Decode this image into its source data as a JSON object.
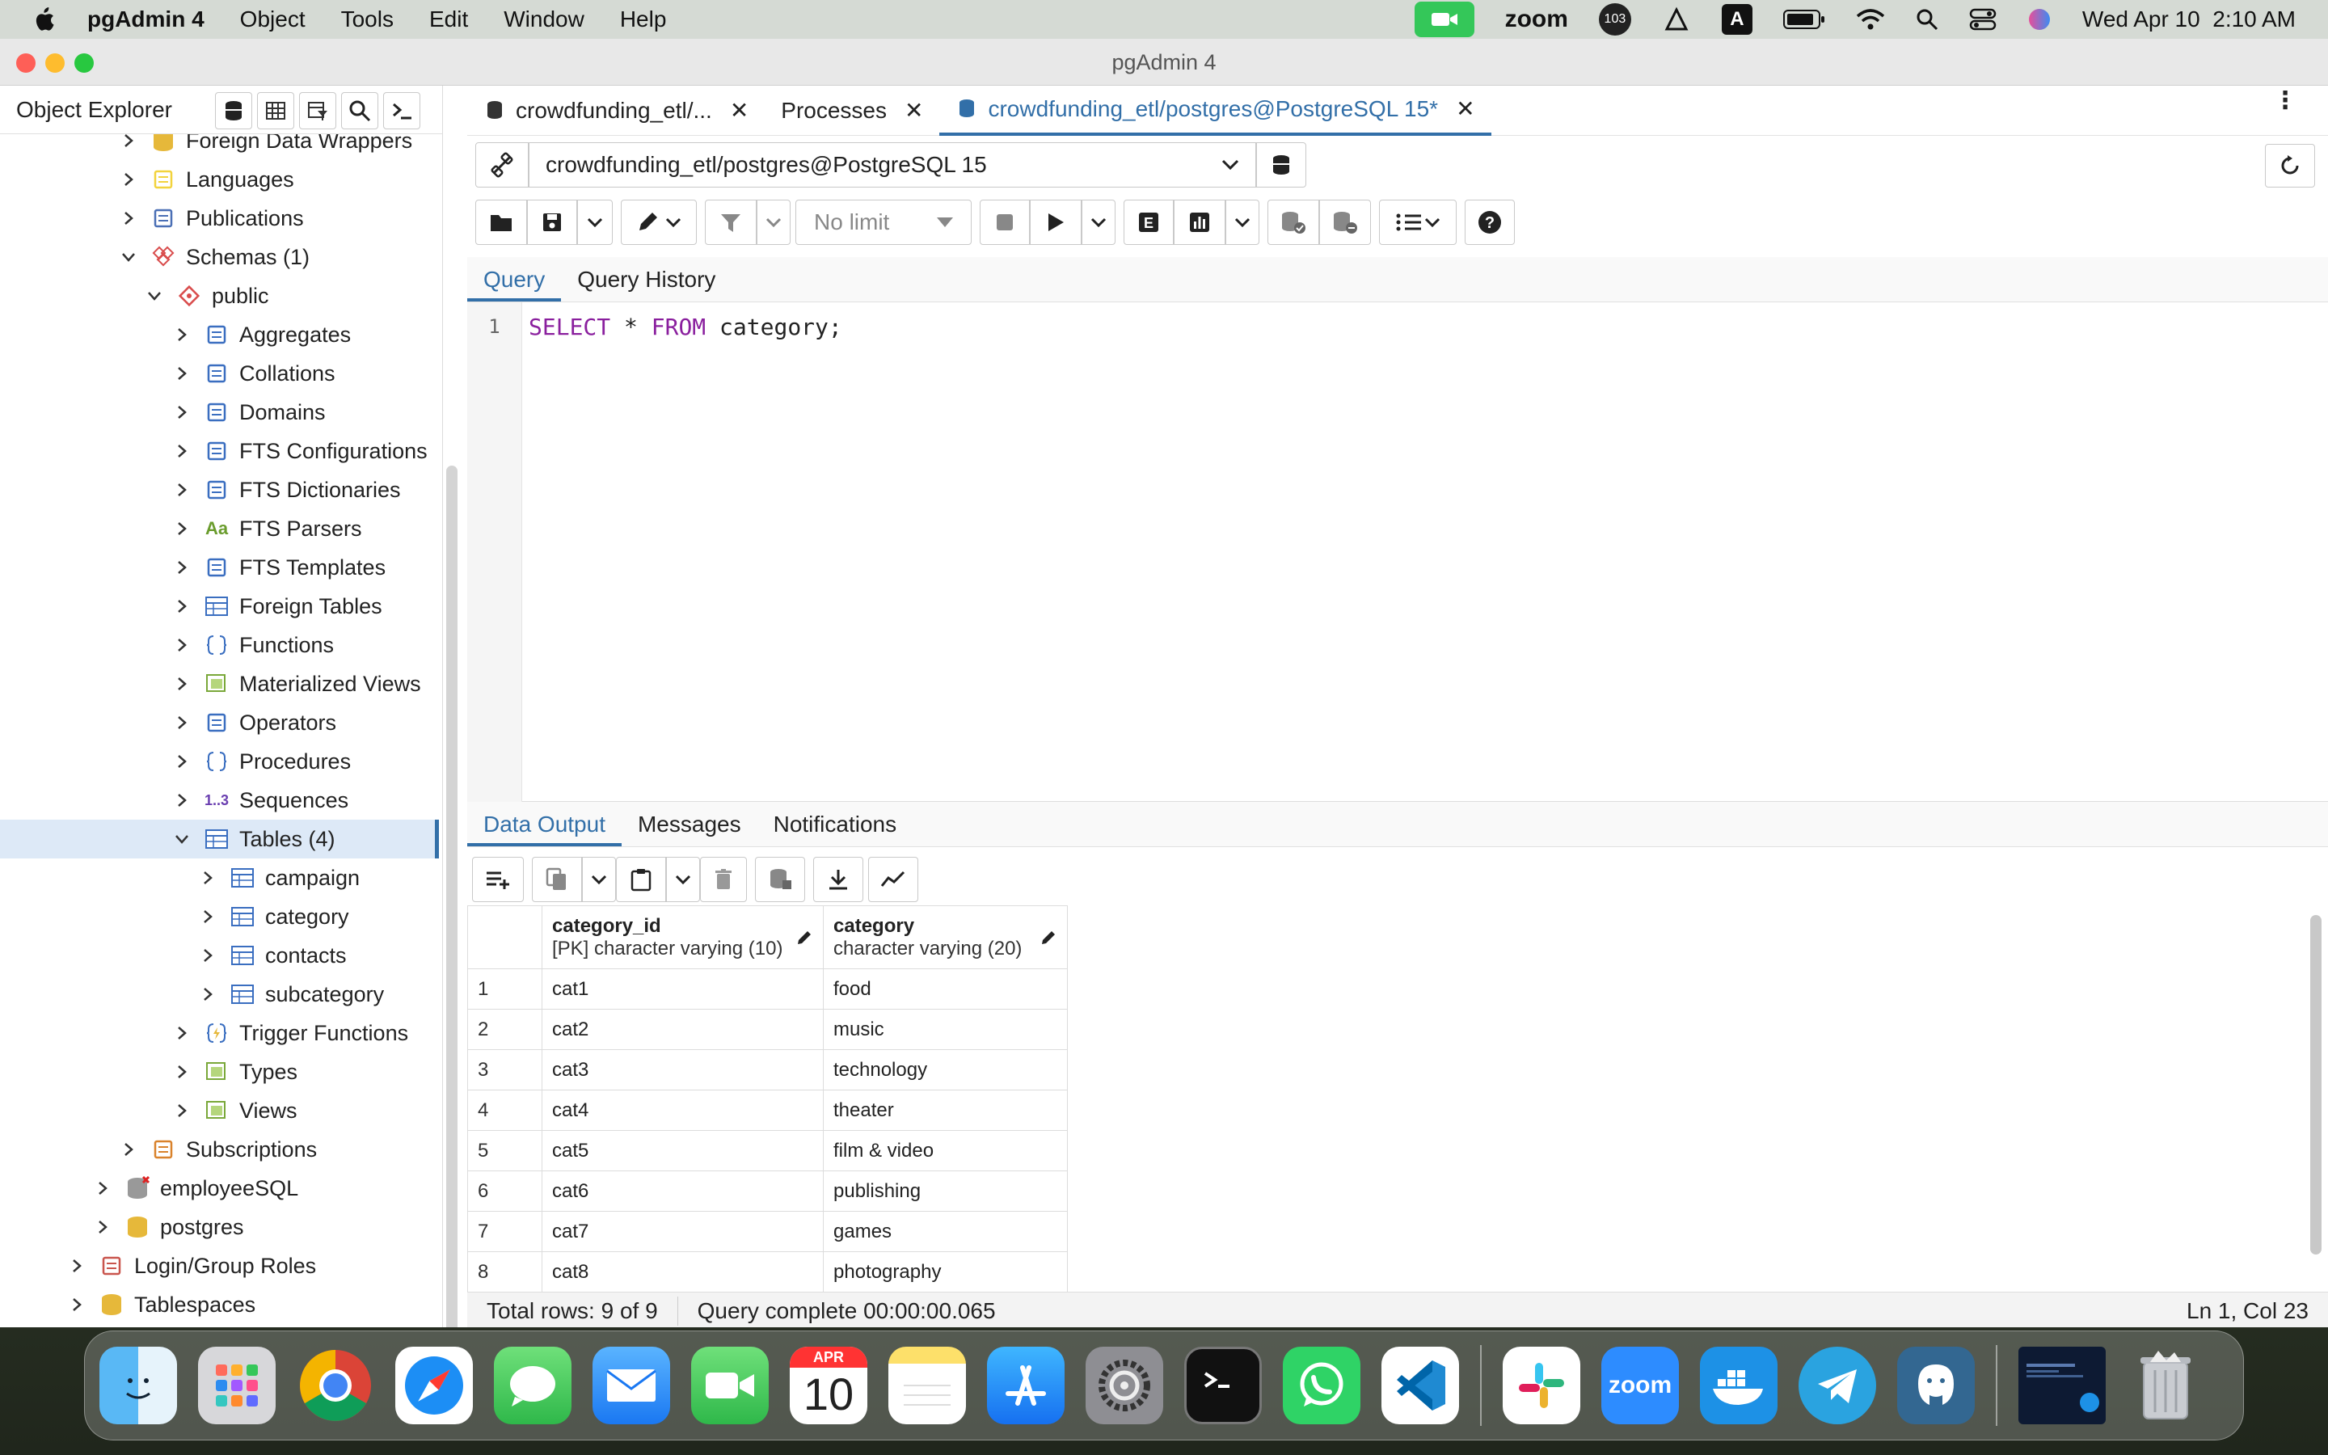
{
  "menubar": {
    "app_name": "pgAdmin 4",
    "items": [
      "Object",
      "Tools",
      "Edit",
      "Window",
      "Help"
    ],
    "zoom_label": "zoom",
    "notification_count": "103",
    "datetime": "Wed Apr 10  2:10 AM"
  },
  "window": {
    "title": "pgAdmin 4"
  },
  "sidebar": {
    "title": "Object Explorer",
    "tree": [
      {
        "label": "Foreign Data Wrappers",
        "icon": "fdw-icon"
      },
      {
        "label": "Languages",
        "icon": "languages-icon"
      },
      {
        "label": "Publications",
        "icon": "publications-icon"
      },
      {
        "label": "Schemas (1)",
        "icon": "schemas-icon"
      },
      {
        "label": "public",
        "icon": "schema-icon"
      },
      {
        "label": "Aggregates",
        "icon": "aggregates-icon"
      },
      {
        "label": "Collations",
        "icon": "collations-icon"
      },
      {
        "label": "Domains",
        "icon": "domains-icon"
      },
      {
        "label": "FTS Configurations",
        "icon": "fts-config-icon"
      },
      {
        "label": "FTS Dictionaries",
        "icon": "fts-dict-icon"
      },
      {
        "label": "FTS Parsers",
        "icon": "fts-parsers-icon"
      },
      {
        "label": "FTS Templates",
        "icon": "fts-templates-icon"
      },
      {
        "label": "Foreign Tables",
        "icon": "foreign-tables-icon"
      },
      {
        "label": "Functions",
        "icon": "functions-icon"
      },
      {
        "label": "Materialized Views",
        "icon": "mviews-icon"
      },
      {
        "label": "Operators",
        "icon": "operators-icon"
      },
      {
        "label": "Procedures",
        "icon": "procedures-icon"
      },
      {
        "label": "Sequences",
        "icon": "sequences-icon"
      },
      {
        "label": "Tables (4)",
        "icon": "tables-icon"
      },
      {
        "label": "campaign",
        "icon": "table-icon"
      },
      {
        "label": "category",
        "icon": "table-icon"
      },
      {
        "label": "contacts",
        "icon": "table-icon"
      },
      {
        "label": "subcategory",
        "icon": "table-icon"
      },
      {
        "label": "Trigger Functions",
        "icon": "trigger-functions-icon"
      },
      {
        "label": "Types",
        "icon": "types-icon"
      },
      {
        "label": "Views",
        "icon": "views-icon"
      },
      {
        "label": "Subscriptions",
        "icon": "subscriptions-icon"
      },
      {
        "label": "employeeSQL",
        "icon": "database-error-icon"
      },
      {
        "label": "postgres",
        "icon": "database-icon"
      },
      {
        "label": "Login/Group Roles",
        "icon": "roles-icon"
      },
      {
        "label": "Tablespaces",
        "icon": "tablespaces-icon"
      }
    ]
  },
  "tabs": [
    {
      "label": "crowdfunding_etl/..."
    },
    {
      "label": "Processes"
    },
    {
      "label": "crowdfunding_etl/postgres@PostgreSQL 15*"
    }
  ],
  "connection": {
    "value": "crowdfunding_etl/postgres@PostgreSQL 15"
  },
  "toolbar": {
    "limit": "No limit"
  },
  "query_tabs": [
    "Query",
    "Query History"
  ],
  "editor": {
    "line_number": "1",
    "keyword1": "SELECT",
    "middle": " * ",
    "keyword2": "FROM",
    "rest": " category;"
  },
  "output_tabs": [
    "Data Output",
    "Messages",
    "Notifications"
  ],
  "grid": {
    "columns": [
      {
        "name": "category_id",
        "type": "[PK] character varying (10)"
      },
      {
        "name": "category",
        "type": "character varying (20)"
      }
    ],
    "rows": [
      [
        "1",
        "cat1",
        "food"
      ],
      [
        "2",
        "cat2",
        "music"
      ],
      [
        "3",
        "cat3",
        "technology"
      ],
      [
        "4",
        "cat4",
        "theater"
      ],
      [
        "5",
        "cat5",
        "film & video"
      ],
      [
        "6",
        "cat6",
        "publishing"
      ],
      [
        "7",
        "cat7",
        "games"
      ],
      [
        "8",
        "cat8",
        "photography"
      ]
    ]
  },
  "status": {
    "rows": "Total rows: 9 of 9",
    "query": "Query complete 00:00:00.065",
    "position": "Ln 1, Col 23"
  },
  "dock": {
    "calendar_month": "APR",
    "calendar_day": "10",
    "zoom_label": "zoom"
  },
  "colors": {
    "accent": "#326fa8",
    "keyword": "#8a1f9e",
    "selected_row": "#dde9f7"
  }
}
